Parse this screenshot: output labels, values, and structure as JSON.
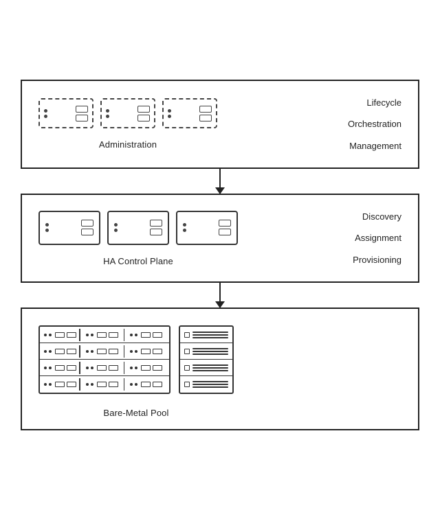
{
  "boxes": [
    {
      "id": "admin",
      "left_label": "Administration",
      "right_labels": [
        "Lifecycle",
        "Orchestration",
        "Management"
      ]
    },
    {
      "id": "control",
      "left_label": "HA Control Plane",
      "right_labels": [
        "Discovery",
        "Assignment",
        "Provisioning"
      ]
    },
    {
      "id": "baremetal",
      "left_label": "Bare-Metal Pool",
      "right_labels": []
    }
  ],
  "arrows": 2
}
